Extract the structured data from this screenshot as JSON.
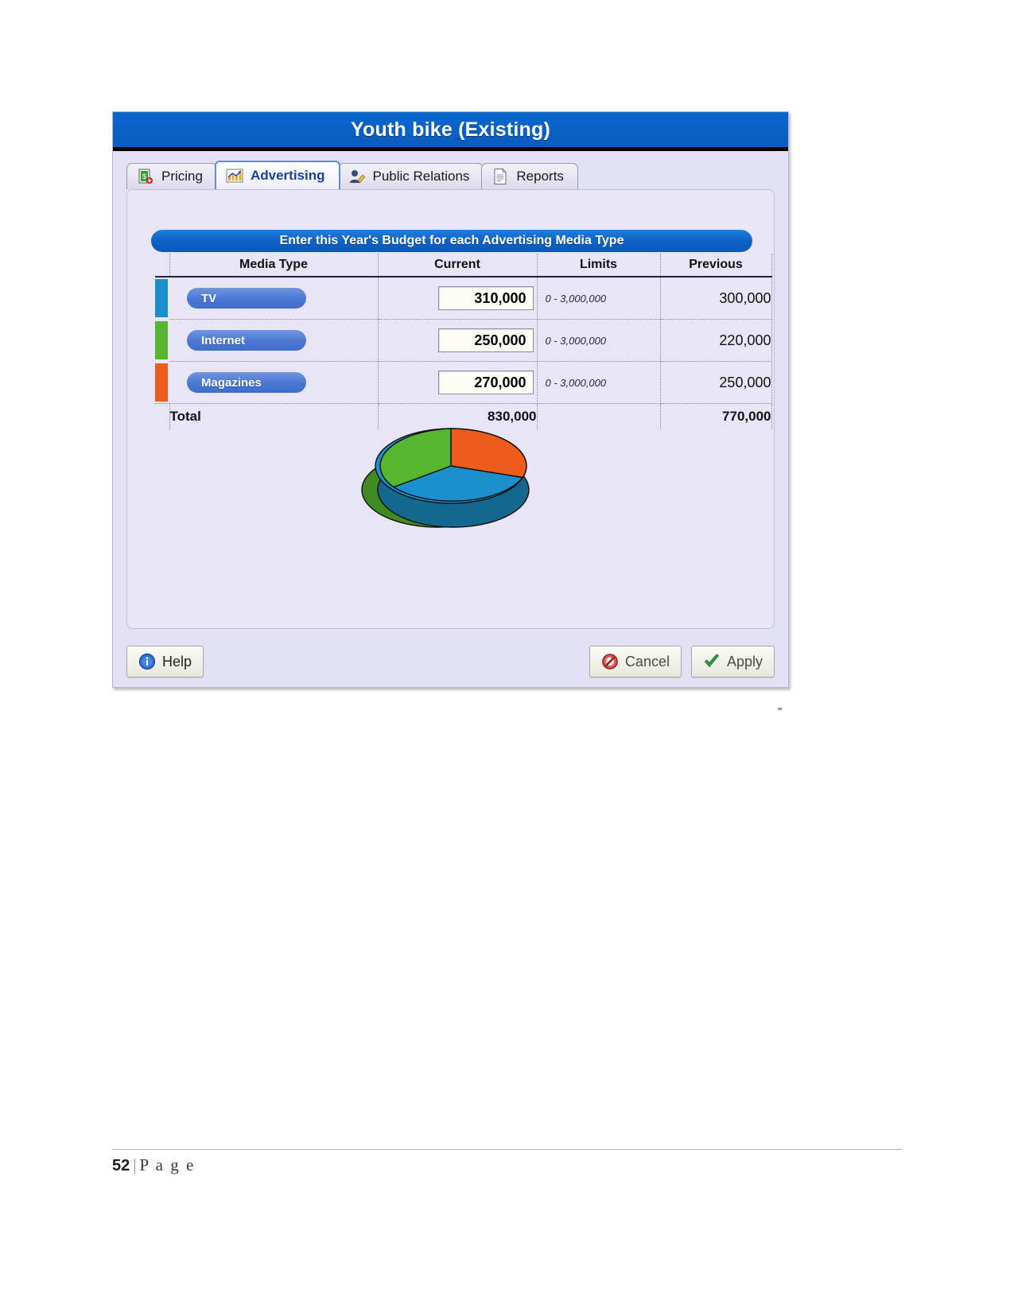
{
  "window": {
    "title": "Youth bike (Existing)",
    "title_bar_color": "#0a61c6"
  },
  "tabs": [
    {
      "label": "Pricing",
      "icon": "pricing-icon",
      "selected": false
    },
    {
      "label": "Advertising",
      "icon": "advertising-chart-icon",
      "selected": true
    },
    {
      "label": "Public Relations",
      "icon": "public-relations-person-icon",
      "selected": false
    },
    {
      "label": "Reports",
      "icon": "reports-document-icon",
      "selected": false
    }
  ],
  "banner": {
    "text": "Enter this Year's Budget for each Advertising Media Type"
  },
  "table": {
    "headers": [
      "Media Type",
      "Current",
      "Limits",
      "Previous"
    ],
    "rows": [
      {
        "media": "TV",
        "swatch": "#1c8fcd",
        "current": "310,000",
        "limits": "0 - 3,000,000",
        "previous": "300,000"
      },
      {
        "media": "Internet",
        "swatch": "#56b630",
        "current": "250,000",
        "limits": "0 - 3,000,000",
        "previous": "220,000"
      },
      {
        "media": "Magazines",
        "swatch": "#ef5a1d",
        "current": "270,000",
        "limits": "0 - 3,000,000",
        "previous": "250,000"
      }
    ],
    "total": {
      "label": "Total",
      "current": "830,000",
      "limits": "",
      "previous": "770,000"
    }
  },
  "chart_data": {
    "type": "pie",
    "title": "",
    "categories": [
      "TV",
      "Internet",
      "Magazines"
    ],
    "values": [
      310000,
      250000,
      270000
    ],
    "percentages": [
      37.3,
      30.1,
      32.5
    ],
    "colors": [
      "#1c8fcd",
      "#56b630",
      "#ef5a1d"
    ],
    "legend": "none",
    "style": "3d-exploded-none",
    "total": 830000
  },
  "buttons": {
    "help": "Help",
    "cancel": "Cancel",
    "apply": "Apply"
  },
  "page_footer": {
    "number": "52",
    "separator": "|",
    "word": "P a g e"
  }
}
